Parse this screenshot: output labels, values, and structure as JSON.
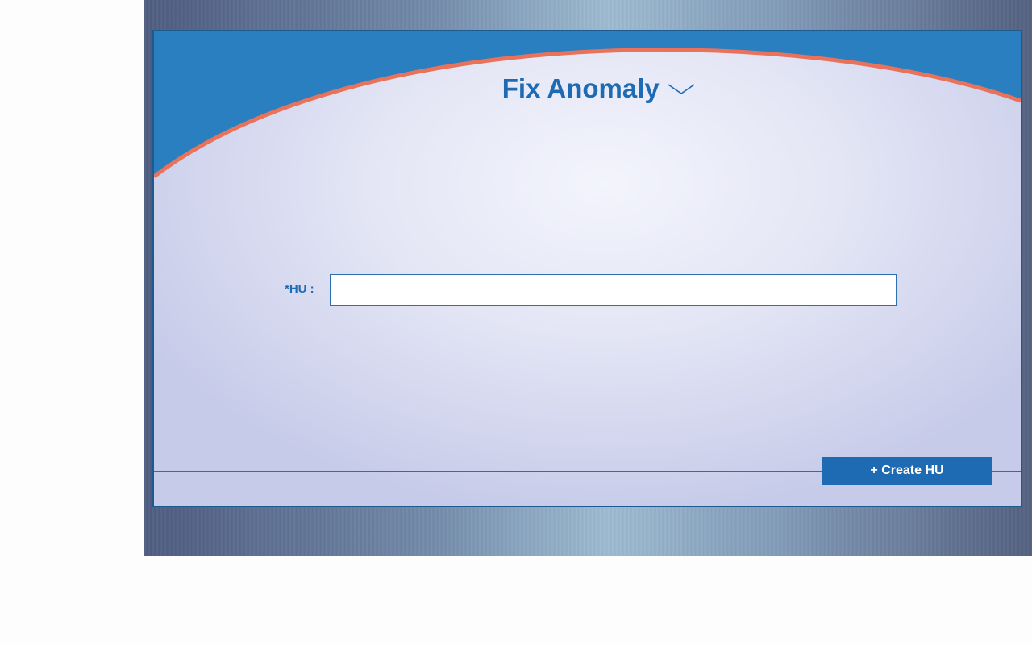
{
  "page": {
    "title": "Fix Anomaly",
    "title_menu_icon": "chevron-down-icon"
  },
  "form": {
    "hu_label": "*HU :",
    "hu_value": "",
    "hu_placeholder": ""
  },
  "actions": {
    "create_hu_label": "+ Create HU"
  },
  "colors": {
    "brand_blue": "#1f6bb3",
    "header_blue": "#2a7fc1",
    "accent_orange": "#e8735a",
    "panel_border": "#1d5a8e"
  }
}
